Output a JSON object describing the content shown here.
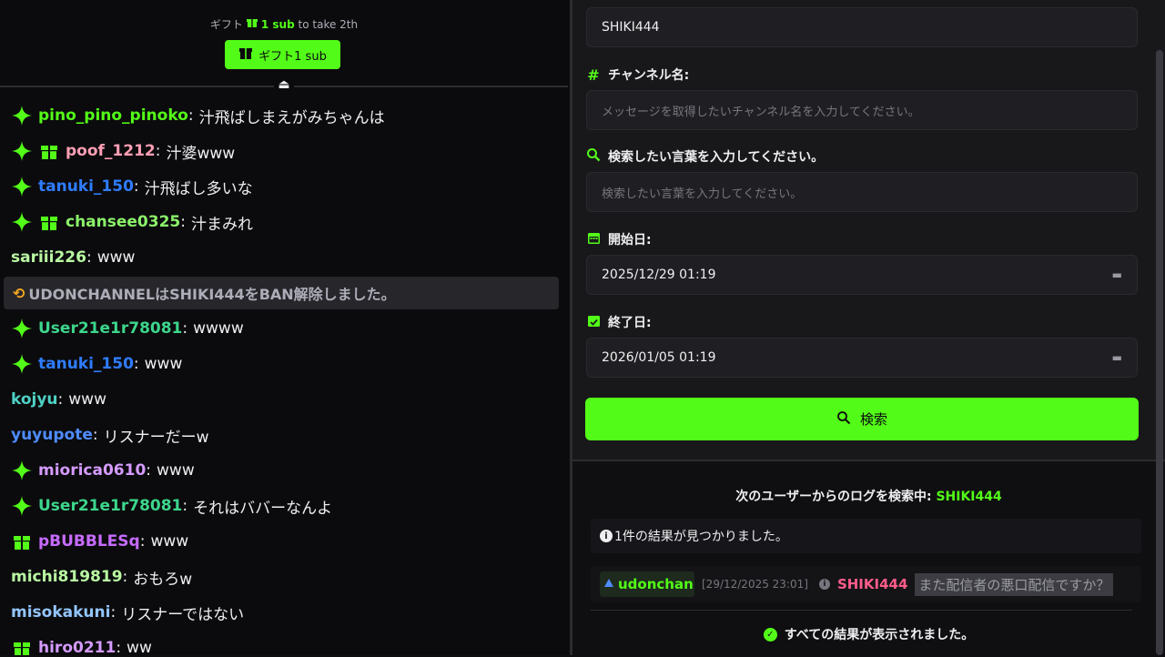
{
  "colors": {
    "accent": "#53fc18",
    "background": "#0e0e10"
  },
  "gift": {
    "line_prefix": "ギフト",
    "line_count": "1 sub",
    "line_suffix": "to take 2th",
    "button_label": "ギフト1 sub"
  },
  "chat": {
    "messages": [
      {
        "user": "pino_pino_pinoko",
        "text": "汁飛ばしまえがみちゃんは",
        "color": "#53fc18",
        "badges": [
          "sparkle-icon"
        ]
      },
      {
        "user": "poof_1212",
        "text": "汁婆www",
        "color": "#ff9fb5",
        "badges": [
          "sparkle-icon",
          "gift-icon"
        ]
      },
      {
        "user": "tanuki_150",
        "text": "汁飛ばし多いな",
        "color": "#2f7cff",
        "badges": [
          "sparkle-icon"
        ]
      },
      {
        "user": "chansee0325",
        "text": "汁まみれ",
        "color": "#8cf26a",
        "badges": [
          "sparkle-icon",
          "gift-icon"
        ]
      },
      {
        "user": "sariii226",
        "text": "www",
        "color": "#b9f7a2",
        "badges": []
      },
      {
        "user": "User21e1r78081",
        "text": "wwww",
        "color": "#3dd68c",
        "badges": [
          "sparkle-icon"
        ]
      },
      {
        "user": "tanuki_150",
        "text": "www",
        "color": "#2f7cff",
        "badges": [
          "sparkle-icon"
        ]
      },
      {
        "user": "kojyu",
        "text": "www",
        "color": "#4fd1c5",
        "badges": []
      },
      {
        "user": "yuyupote",
        "text": "リスナーだーw",
        "color": "#4f8cff",
        "badges": []
      },
      {
        "user": "miorica0610",
        "text": "www",
        "color": "#d59bff",
        "badges": [
          "sparkle-icon"
        ]
      },
      {
        "user": "User21e1r78081",
        "text": "それはババーなんよ",
        "color": "#3dd68c",
        "badges": [
          "sparkle-icon"
        ]
      },
      {
        "user": "pBUBBLESq",
        "text": "www",
        "color": "#c86bff",
        "badges": [
          "gift-icon"
        ]
      },
      {
        "user": "michi819819",
        "text": "おもろw",
        "color": "#b9f7a2",
        "badges": []
      },
      {
        "user": "misokakuni",
        "text": "リスナーではない",
        "color": "#93c5fd",
        "badges": []
      },
      {
        "user": "hiro0211",
        "text": "ww",
        "color": "#d59bff",
        "badges": [
          "gift-icon"
        ]
      }
    ],
    "system_message": "UDONCHANNELはSHIKI444をBAN解除しました。"
  },
  "form": {
    "username_value": "SHIKI444",
    "channel_label": "チャンネル名:",
    "channel_placeholder": "メッセージを取得したいチャンネル名を入力してください。",
    "keyword_label": "検索したい言葉を入力してください。",
    "keyword_placeholder": "検索したい言葉を入力してください。",
    "start_label": "開始日:",
    "start_value": "2025/12/29 01:19",
    "end_label": "終了日:",
    "end_value": "2026/01/05 01:19",
    "search_label": "検索"
  },
  "results": {
    "search_info_prefix": "次のユーザーからのログを検索中:",
    "search_info_user": "SHIKI444",
    "count_text": "1件の結果が見つかりました。",
    "row": {
      "channel": "udonchanı",
      "timestamp": "[29/12/2025 23:01]",
      "user": "SHIKI444",
      "message": "また配信者の悪口配信ですか？"
    },
    "done_text": "すべての結果が表示されました。"
  }
}
